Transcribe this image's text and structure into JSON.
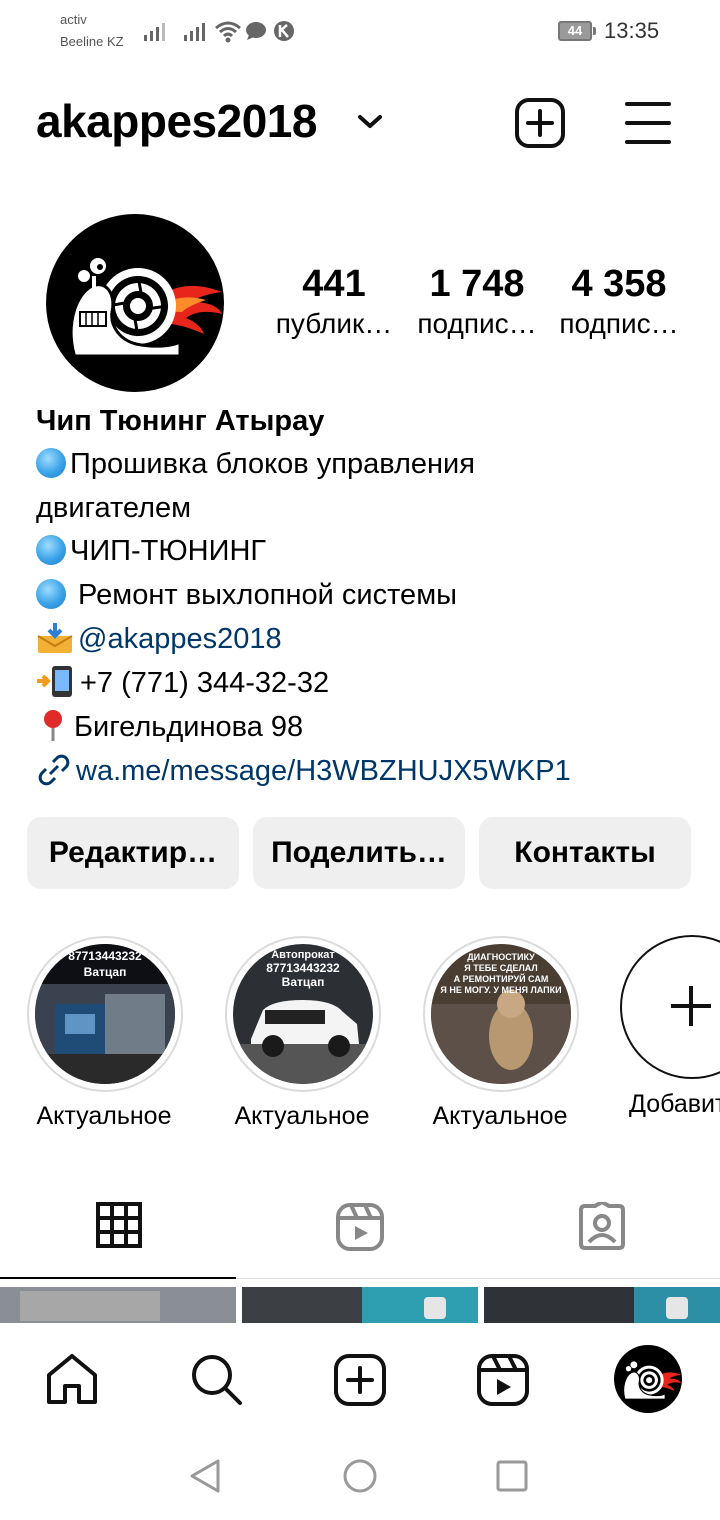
{
  "status_bar": {
    "carrier_line1": "activ",
    "carrier_line2": "Beeline KZ",
    "battery": "44",
    "time": "13:35"
  },
  "header": {
    "username": "akappes2018",
    "chevron_icon": "chevron-down-icon",
    "new_post_icon": "plus-square-icon",
    "menu_icon": "hamburger-menu-icon"
  },
  "stats": [
    {
      "value": "441",
      "label": "публик…"
    },
    {
      "value": "1 748",
      "label": "подпис…"
    },
    {
      "value": "4 358",
      "label": "подпис…"
    }
  ],
  "bio": {
    "name": "Чип Тюнинг Атырау",
    "line1": "Прошивка блоков управления",
    "line2": "двигателем",
    "line3": "ЧИП-ТЮНИНГ",
    "line4": " Ремонт выхлопной системы",
    "mention": "@akappes2018",
    "phone": "+7 (771) 344-32-32",
    "address": "Бигельдинова 98",
    "link": "wa.me/message/H3WBZHUJX5WKP1"
  },
  "buttons": {
    "edit": "Редактир…",
    "share": "Поделить…",
    "contacts": "Контакты"
  },
  "highlights": [
    {
      "label": "Актуальное",
      "caption": "87713443232 Ватцап"
    },
    {
      "label": "Актуальное",
      "caption": "Автопрокат 87713443232 Ватцап"
    },
    {
      "label": "Актуальное",
      "caption": "ДИАГНОСТИКУ Я ТЕБЕ СДЕЛАЛ А РЕМОНТИРУЙ САМ Я НЕ МОГУ. У МЕНЯ ЛАПКИ"
    },
    {
      "label": "Добавить"
    }
  ],
  "colors": {
    "link": "#00376b",
    "button_bg": "#efefef",
    "avatar_bg": "#000000",
    "flame": "#e8251a"
  }
}
